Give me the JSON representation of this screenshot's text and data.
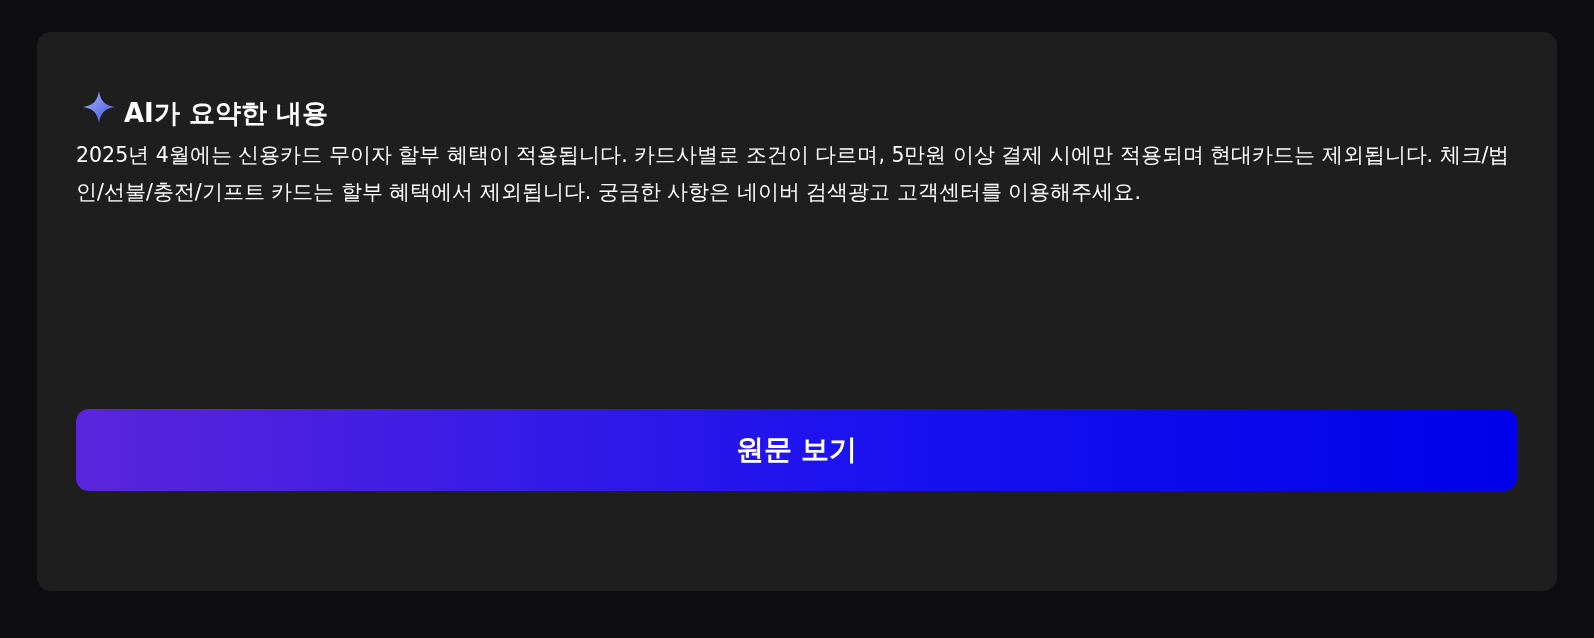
{
  "summary": {
    "title": "AI가 요약한 내용",
    "text": "2025년 4월에는 신용카드 무이자 할부 혜택이 적용됩니다. 카드사별로 조건이 다르며, 5만원 이상 결제 시에만 적용되며 현대카드는 제외됩니다. 체크/법인/선불/충전/기프트 카드는 할부 혜택에서 제외됩니다. 궁금한 사항은 네이버 검색광고 고객센터를 이용해주세요."
  },
  "button": {
    "label": "원문 보기"
  }
}
